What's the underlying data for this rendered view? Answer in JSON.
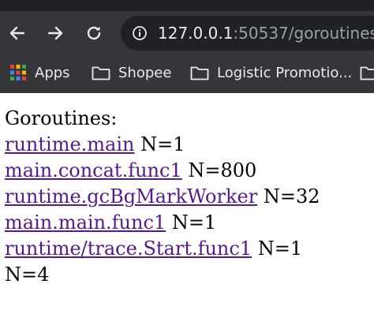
{
  "browser": {
    "url_host": "127.0.0.1",
    "url_rest": ":50537/goroutines",
    "bookmarks": [
      {
        "label": "Apps",
        "icon": "apps-grid-icon"
      },
      {
        "label": "Shopee",
        "icon": "folder-icon"
      },
      {
        "label": "Logistic Promotio...",
        "icon": "folder-icon"
      }
    ]
  },
  "page": {
    "title": "Goroutines:",
    "rows": [
      {
        "link": "runtime.main",
        "count": "N=1"
      },
      {
        "link": "main.concat.func1",
        "count": "N=800"
      },
      {
        "link": "runtime.gcBgMarkWorker",
        "count": "N=32"
      },
      {
        "link": "main.main.func1",
        "count": "N=1"
      },
      {
        "link": "runtime/trace.Start.func1",
        "count": "N=1"
      }
    ],
    "total": "N=4"
  },
  "colors": {
    "chrome_bg": "#35363a",
    "omnibox_bg": "#202124",
    "visited_link": "#551a8b"
  }
}
